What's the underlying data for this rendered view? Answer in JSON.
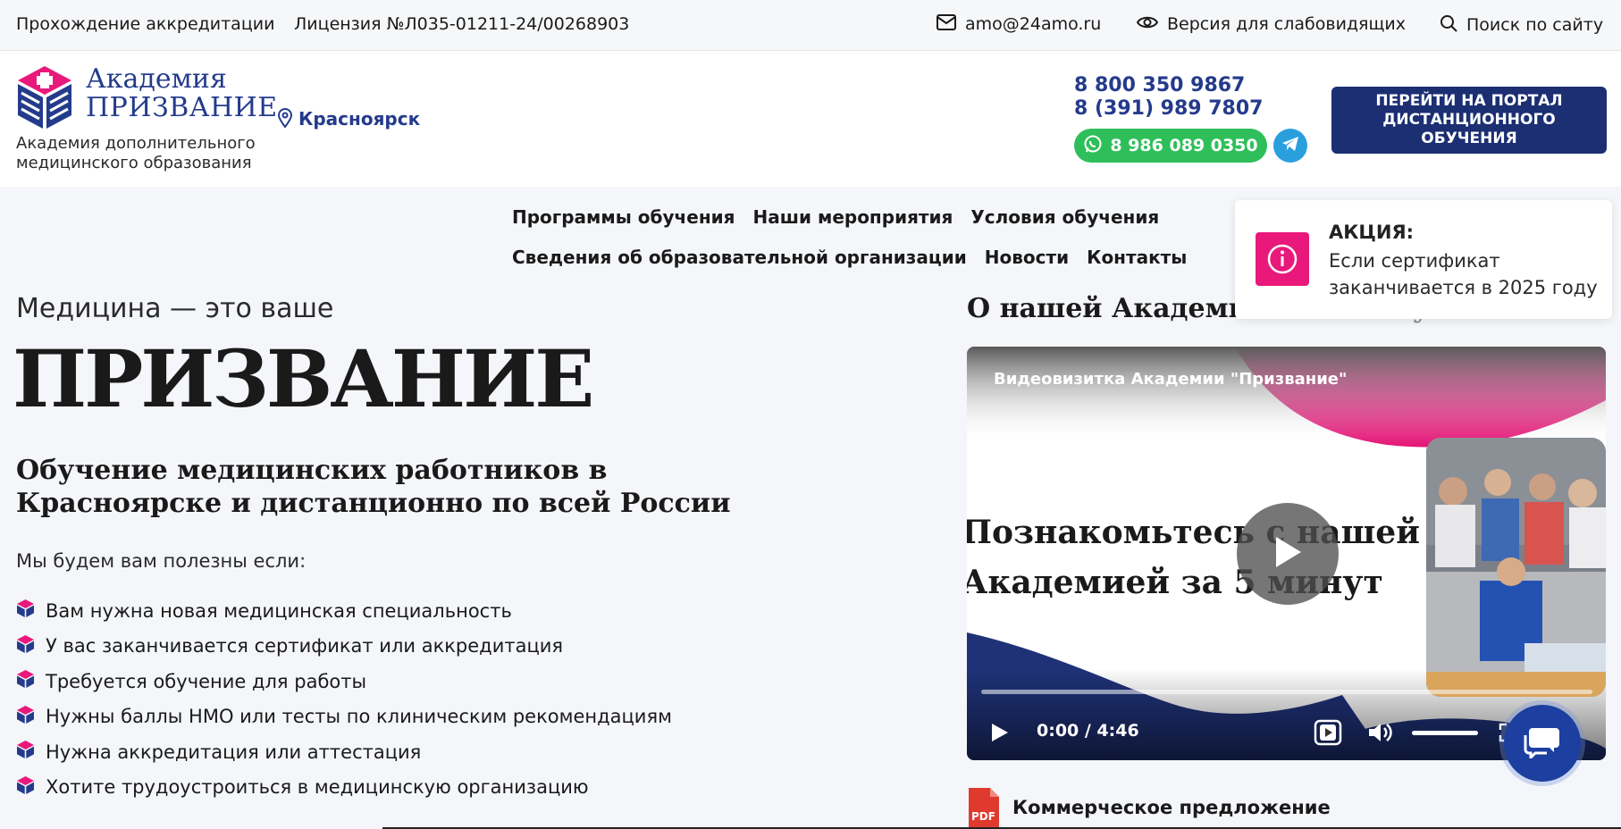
{
  "topbar": {
    "accreditation": "Прохождение аккредитации",
    "license": "Лицензия №Л035-01211-24/00268903",
    "email": "amo@24amo.ru",
    "low_vision": "Версия для слабовидящих",
    "search": "Поиск по сайту"
  },
  "logo": {
    "line1": "Академия",
    "line2": "ПРИЗВАНИЕ",
    "subtitle": "Академия дополнительного медицинского образования",
    "colors": {
      "brand_blue": "#243b8c",
      "brand_pink": "#e9197b"
    }
  },
  "header": {
    "city": "Красноярск",
    "phone1": "8 800 350 9867",
    "phone2": "8 (391) 989 7807",
    "whatsapp": "8 986 089 0350",
    "portal_button": "ПЕРЕЙТИ НА ПОРТАЛ ДИСТАНЦИОННОГО ОБУЧЕНИЯ"
  },
  "nav": {
    "row1": [
      "Программы обучения",
      "Наши мероприятия",
      "Условия обучения"
    ],
    "row2": [
      "Сведения об образовательной организации",
      "Новости",
      "Контакты"
    ]
  },
  "promo": {
    "title": "АКЦИЯ:",
    "text": "Если сертификат заканчивается в 2025 году"
  },
  "hero": {
    "pre": "Медицина — это ваше",
    "big": "ПРИЗВАНИЕ",
    "sub": "Обучение медицинских работников в Красноярске и дистанционно по всей России",
    "lead": "Мы будем вам полезны если:",
    "bullets": [
      "Вам нужна новая медицинская специальность",
      "У вас заканчивается сертификат или аккредитация",
      "Требуется обучение для работы",
      "Нужны баллы НМО или тесты по клиническим рекомендациям",
      "Нужна аккредитация или аттестация",
      "Хотите трудоустроиться в медицинскую организацию"
    ]
  },
  "about": {
    "title": "О нашей Академии",
    "title_faded": "за 5 минут"
  },
  "video": {
    "title": "Видеовизитка Академии \"Призвание\"",
    "slide_line1": "Познакомьтесь с нашей",
    "slide_line2": "Академией за 5 минут",
    "time": "0:00 / 4:46",
    "progress": 0
  },
  "document": {
    "pdf_label": "PDF",
    "title": "Коммерческое предложение"
  }
}
